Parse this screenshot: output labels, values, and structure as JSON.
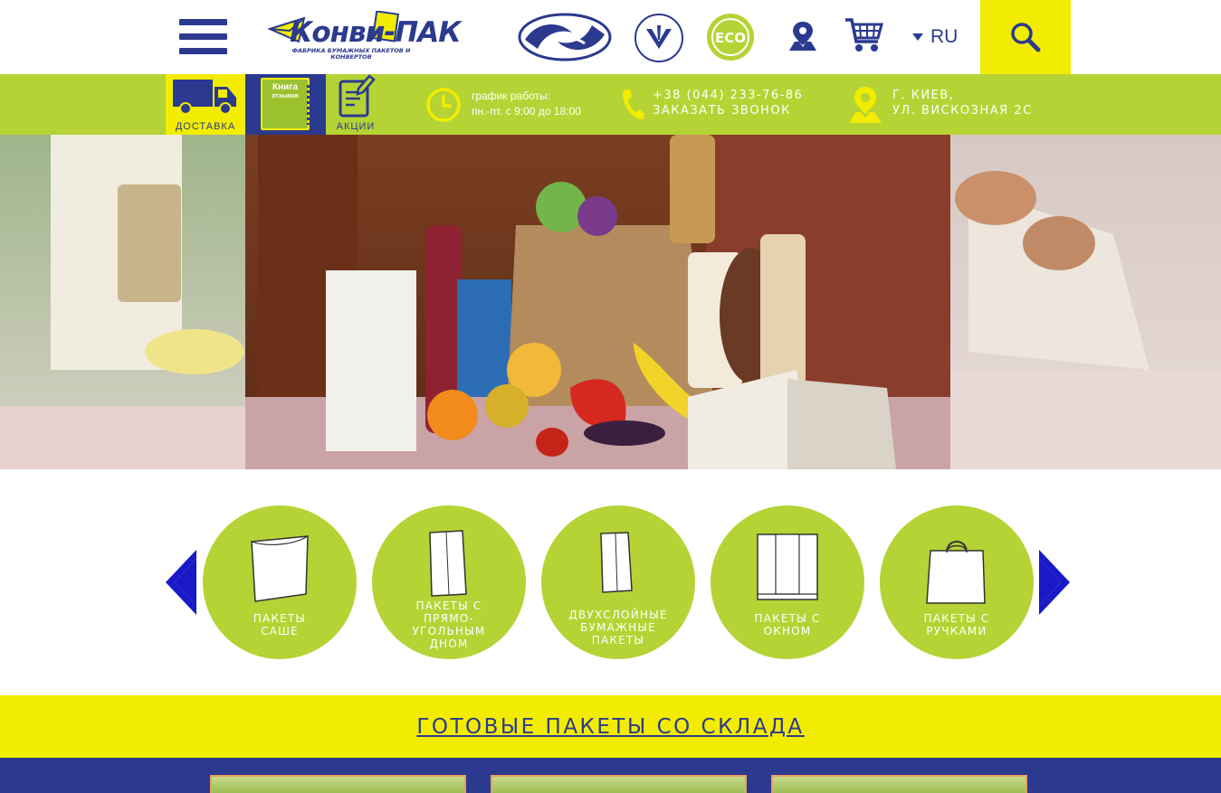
{
  "header": {
    "logo_text": "Конви-ПАК",
    "logo_subtitle": "ФАБРИКА БУМАЖНЫХ ПАКЕТОВ И КОНВЕРТОВ",
    "cert_eco_label": "ECO",
    "language": "RU"
  },
  "infobar": {
    "delivery_label": "ДОСТАВКА",
    "book_title": "Книга",
    "book_subtitle": "отзывов",
    "promo_label": "АКЦИИ",
    "hours_title": "график работы:",
    "hours_text": "пн.-пт. с 9:00 до 18:00",
    "phone": "+38 (044) 233-76-86",
    "callback": "ЗАКАЗАТЬ ЗВОНОК",
    "city": "Г. КИЕВ,",
    "street": "УЛ. ВИСКОЗНАЯ 2С"
  },
  "categories": [
    {
      "label": "ПАКЕТЫ\nСАШЕ",
      "icon": "sachet-bag-icon"
    },
    {
      "label": "ПАКЕТЫ С\nПРЯМО-\nУГОЛЬНЫМ\nДНОМ",
      "icon": "flat-bottom-bag-icon"
    },
    {
      "label": "ДВУХСЛОЙНЫЕ\nБУМАЖНЫЕ\nПАКЕТЫ",
      "icon": "double-layer-bag-icon"
    },
    {
      "label": "ПАКЕТЫ С\nОКНОМ",
      "icon": "window-bag-icon"
    },
    {
      "label": "ПАКЕТЫ С\nРУЧКАМИ",
      "icon": "handle-bag-icon"
    }
  ],
  "stock": {
    "link_label": "ГОТОВЫЕ ПАКЕТЫ СО СКЛАДА"
  },
  "colors": {
    "brand_blue": "#2b3a8f",
    "brand_green": "#b5d334",
    "brand_yellow": "#f2ec00"
  }
}
